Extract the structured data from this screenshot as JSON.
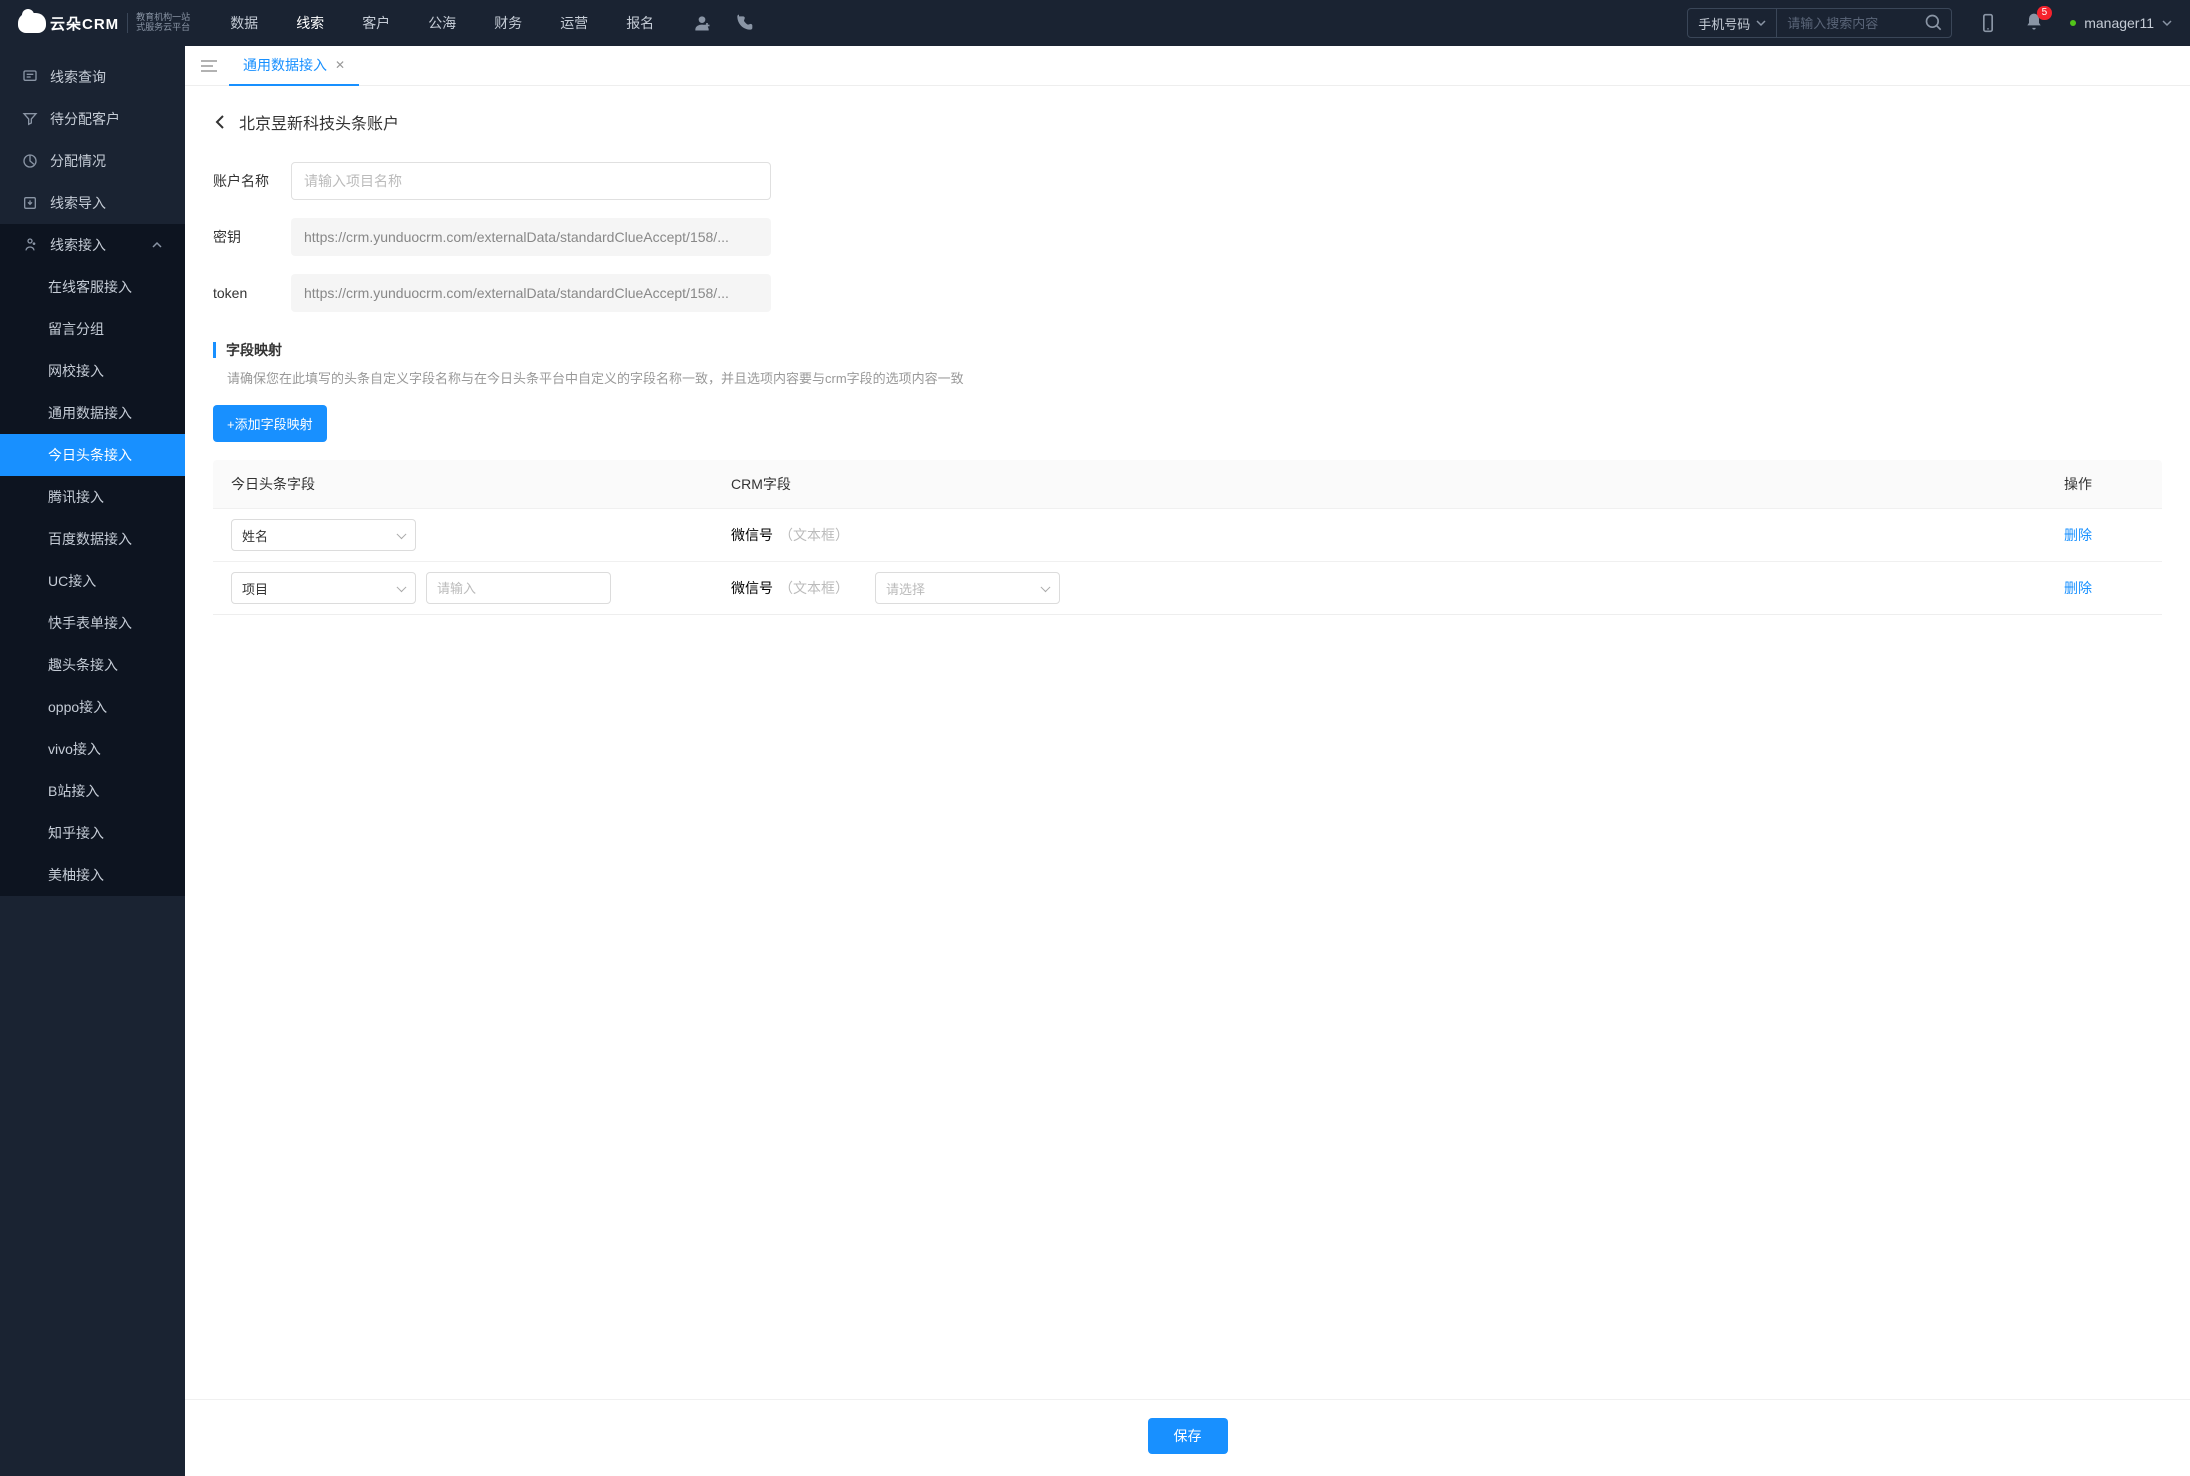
{
  "brand": {
    "name": "云朵CRM",
    "subtitle1": "教育机构一站",
    "subtitle2": "式服务云平台"
  },
  "topnav": [
    "数据",
    "线索",
    "客户",
    "公海",
    "财务",
    "运营",
    "报名"
  ],
  "activeNav": "线索",
  "search": {
    "selector": "手机号码",
    "placeholder": "请输入搜索内容"
  },
  "notifications": {
    "count": "5"
  },
  "user": {
    "name": "manager11"
  },
  "sidebar": [
    {
      "icon": "query",
      "label": "线索查询"
    },
    {
      "icon": "filter",
      "label": "待分配客户"
    },
    {
      "icon": "chart",
      "label": "分配情况"
    },
    {
      "icon": "import",
      "label": "线索导入"
    },
    {
      "icon": "access",
      "label": "线索接入",
      "expanded": true,
      "children": [
        "在线客服接入",
        "留言分组",
        "网校接入",
        "通用数据接入",
        "今日头条接入",
        "腾讯接入",
        "百度数据接入",
        "UC接入",
        "快手表单接入",
        "趣头条接入",
        "oppo接入",
        "vivo接入",
        "B站接入",
        "知乎接入",
        "美柚接入"
      ]
    }
  ],
  "activeSubItem": "今日头条接入",
  "tab": {
    "label": "通用数据接入"
  },
  "page": {
    "title": "北京昱新科技头条账户",
    "fields": {
      "name_label": "账户名称",
      "name_placeholder": "请输入项目名称",
      "secret_label": "密钥",
      "secret_value": "https://crm.yunduocrm.com/externalData/standardClueAccept/158/...",
      "token_label": "token",
      "token_value": "https://crm.yunduocrm.com/externalData/standardClueAccept/158/..."
    },
    "section": {
      "title": "字段映射",
      "note": "请确保您在此填写的头条自定义字段名称与在今日头条平台中自定义的字段名称一致，并且选项内容要与crm字段的选项内容一致"
    },
    "addButton": "+添加字段映射",
    "tableHeaders": {
      "c1": "今日头条字段",
      "c2": "CRM字段",
      "c3": "操作"
    },
    "rows": [
      {
        "field": "姓名",
        "hasInput": false,
        "crm": "微信号",
        "crmHint": "（文本框）",
        "hasSelect": false,
        "action": "删除"
      },
      {
        "field": "项目",
        "hasInput": true,
        "inputPlaceholder": "请输入",
        "crm": "微信号",
        "crmHint": "（文本框）",
        "hasSelect": true,
        "selectPlaceholder": "请选择",
        "action": "删除"
      }
    ],
    "save": "保存"
  }
}
